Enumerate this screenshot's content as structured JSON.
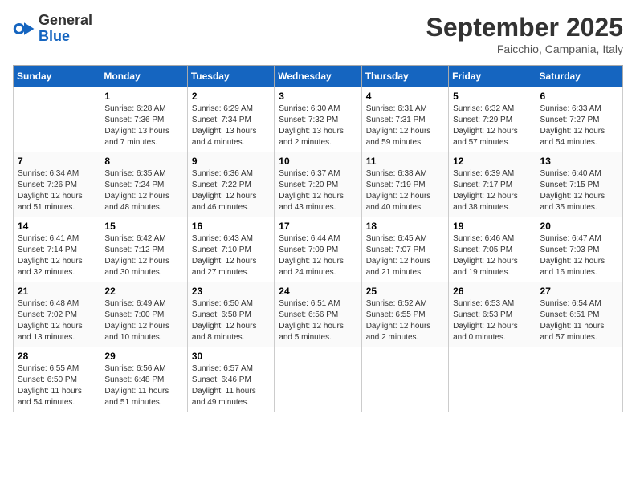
{
  "header": {
    "logo_general": "General",
    "logo_blue": "Blue",
    "month_title": "September 2025",
    "location": "Faicchio, Campania, Italy"
  },
  "days_of_week": [
    "Sunday",
    "Monday",
    "Tuesday",
    "Wednesday",
    "Thursday",
    "Friday",
    "Saturday"
  ],
  "weeks": [
    [
      {
        "day": "",
        "content": ""
      },
      {
        "day": "1",
        "content": "Sunrise: 6:28 AM\nSunset: 7:36 PM\nDaylight: 13 hours\nand 7 minutes."
      },
      {
        "day": "2",
        "content": "Sunrise: 6:29 AM\nSunset: 7:34 PM\nDaylight: 13 hours\nand 4 minutes."
      },
      {
        "day": "3",
        "content": "Sunrise: 6:30 AM\nSunset: 7:32 PM\nDaylight: 13 hours\nand 2 minutes."
      },
      {
        "day": "4",
        "content": "Sunrise: 6:31 AM\nSunset: 7:31 PM\nDaylight: 12 hours\nand 59 minutes."
      },
      {
        "day": "5",
        "content": "Sunrise: 6:32 AM\nSunset: 7:29 PM\nDaylight: 12 hours\nand 57 minutes."
      },
      {
        "day": "6",
        "content": "Sunrise: 6:33 AM\nSunset: 7:27 PM\nDaylight: 12 hours\nand 54 minutes."
      }
    ],
    [
      {
        "day": "7",
        "content": "Sunrise: 6:34 AM\nSunset: 7:26 PM\nDaylight: 12 hours\nand 51 minutes."
      },
      {
        "day": "8",
        "content": "Sunrise: 6:35 AM\nSunset: 7:24 PM\nDaylight: 12 hours\nand 48 minutes."
      },
      {
        "day": "9",
        "content": "Sunrise: 6:36 AM\nSunset: 7:22 PM\nDaylight: 12 hours\nand 46 minutes."
      },
      {
        "day": "10",
        "content": "Sunrise: 6:37 AM\nSunset: 7:20 PM\nDaylight: 12 hours\nand 43 minutes."
      },
      {
        "day": "11",
        "content": "Sunrise: 6:38 AM\nSunset: 7:19 PM\nDaylight: 12 hours\nand 40 minutes."
      },
      {
        "day": "12",
        "content": "Sunrise: 6:39 AM\nSunset: 7:17 PM\nDaylight: 12 hours\nand 38 minutes."
      },
      {
        "day": "13",
        "content": "Sunrise: 6:40 AM\nSunset: 7:15 PM\nDaylight: 12 hours\nand 35 minutes."
      }
    ],
    [
      {
        "day": "14",
        "content": "Sunrise: 6:41 AM\nSunset: 7:14 PM\nDaylight: 12 hours\nand 32 minutes."
      },
      {
        "day": "15",
        "content": "Sunrise: 6:42 AM\nSunset: 7:12 PM\nDaylight: 12 hours\nand 30 minutes."
      },
      {
        "day": "16",
        "content": "Sunrise: 6:43 AM\nSunset: 7:10 PM\nDaylight: 12 hours\nand 27 minutes."
      },
      {
        "day": "17",
        "content": "Sunrise: 6:44 AM\nSunset: 7:09 PM\nDaylight: 12 hours\nand 24 minutes."
      },
      {
        "day": "18",
        "content": "Sunrise: 6:45 AM\nSunset: 7:07 PM\nDaylight: 12 hours\nand 21 minutes."
      },
      {
        "day": "19",
        "content": "Sunrise: 6:46 AM\nSunset: 7:05 PM\nDaylight: 12 hours\nand 19 minutes."
      },
      {
        "day": "20",
        "content": "Sunrise: 6:47 AM\nSunset: 7:03 PM\nDaylight: 12 hours\nand 16 minutes."
      }
    ],
    [
      {
        "day": "21",
        "content": "Sunrise: 6:48 AM\nSunset: 7:02 PM\nDaylight: 12 hours\nand 13 minutes."
      },
      {
        "day": "22",
        "content": "Sunrise: 6:49 AM\nSunset: 7:00 PM\nDaylight: 12 hours\nand 10 minutes."
      },
      {
        "day": "23",
        "content": "Sunrise: 6:50 AM\nSunset: 6:58 PM\nDaylight: 12 hours\nand 8 minutes."
      },
      {
        "day": "24",
        "content": "Sunrise: 6:51 AM\nSunset: 6:56 PM\nDaylight: 12 hours\nand 5 minutes."
      },
      {
        "day": "25",
        "content": "Sunrise: 6:52 AM\nSunset: 6:55 PM\nDaylight: 12 hours\nand 2 minutes."
      },
      {
        "day": "26",
        "content": "Sunrise: 6:53 AM\nSunset: 6:53 PM\nDaylight: 12 hours\nand 0 minutes."
      },
      {
        "day": "27",
        "content": "Sunrise: 6:54 AM\nSunset: 6:51 PM\nDaylight: 11 hours\nand 57 minutes."
      }
    ],
    [
      {
        "day": "28",
        "content": "Sunrise: 6:55 AM\nSunset: 6:50 PM\nDaylight: 11 hours\nand 54 minutes."
      },
      {
        "day": "29",
        "content": "Sunrise: 6:56 AM\nSunset: 6:48 PM\nDaylight: 11 hours\nand 51 minutes."
      },
      {
        "day": "30",
        "content": "Sunrise: 6:57 AM\nSunset: 6:46 PM\nDaylight: 11 hours\nand 49 minutes."
      },
      {
        "day": "",
        "content": ""
      },
      {
        "day": "",
        "content": ""
      },
      {
        "day": "",
        "content": ""
      },
      {
        "day": "",
        "content": ""
      }
    ]
  ]
}
